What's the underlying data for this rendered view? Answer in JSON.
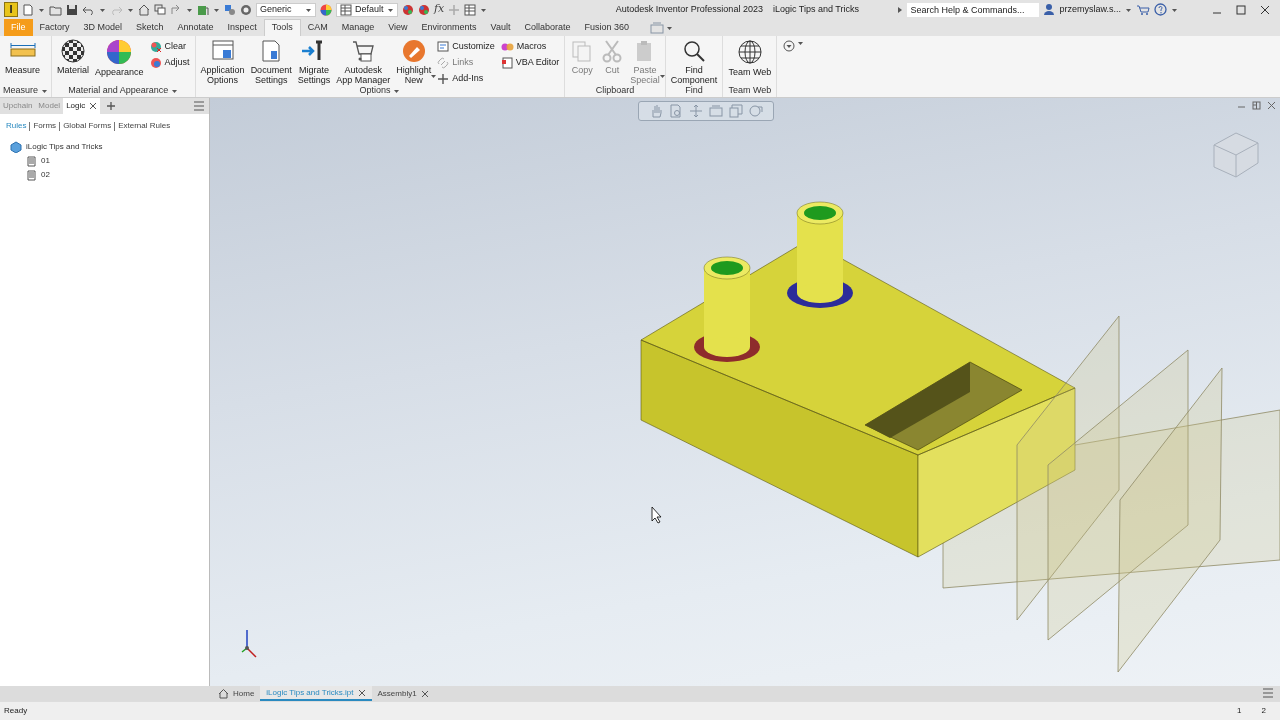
{
  "title_bar": {
    "app_logo": "I",
    "style": "Generic",
    "appearance": "Default",
    "parameters_label": "fx",
    "app_title": "Autodesk Inventor Professional 2023",
    "document_title": "iLogic Tips and Tricks",
    "search": {
      "placeholder": "Search Help & Commands..."
    },
    "user": "przemyslaw.s..."
  },
  "ribbon_tabs": [
    {
      "label": "File",
      "kind": "application",
      "selected": false
    },
    {
      "label": "Factory",
      "kind": "tab",
      "selected": false
    },
    {
      "label": "3D Model",
      "kind": "tab",
      "selected": false
    },
    {
      "label": "Sketch",
      "kind": "tab",
      "selected": false
    },
    {
      "label": "Annotate",
      "kind": "tab",
      "selected": false
    },
    {
      "label": "Inspect",
      "kind": "tab",
      "selected": false
    },
    {
      "label": "Tools",
      "kind": "tab",
      "selected": true
    },
    {
      "label": "CAM",
      "kind": "tab",
      "selected": false
    },
    {
      "label": "Manage",
      "kind": "tab",
      "selected": false
    },
    {
      "label": "View",
      "kind": "tab",
      "selected": false
    },
    {
      "label": "Environments",
      "kind": "tab",
      "selected": false
    },
    {
      "label": "Vault",
      "kind": "tab",
      "selected": false
    },
    {
      "label": "Collaborate",
      "kind": "tab",
      "selected": false
    },
    {
      "label": "Fusion 360",
      "kind": "tab",
      "selected": false
    }
  ],
  "ribbon_panels": [
    {
      "title": "Measure",
      "has_menu": true,
      "commands": [
        {
          "label": "Measure",
          "kind": "large",
          "disabled": false,
          "has_menu": false
        }
      ]
    },
    {
      "title": "Material and Appearance",
      "has_menu": true,
      "commands": [
        {
          "label": "Material",
          "kind": "large",
          "disabled": false,
          "has_menu": false
        },
        {
          "label": "Appearance",
          "kind": "large",
          "disabled": false,
          "has_menu": false
        },
        {
          "label": "Clear",
          "kind": "small",
          "disabled": false,
          "has_menu": false
        },
        {
          "label": "Adjust",
          "kind": "small",
          "disabled": false,
          "has_menu": false
        }
      ]
    },
    {
      "title": "Options",
      "has_menu": true,
      "commands": [
        {
          "label": "Application\nOptions",
          "kind": "large",
          "disabled": false,
          "has_menu": false
        },
        {
          "label": "Document\nSettings",
          "kind": "large",
          "disabled": false,
          "has_menu": false
        },
        {
          "label": "Migrate\nSettings",
          "kind": "large",
          "disabled": false,
          "has_menu": false
        },
        {
          "label": "Autodesk\nApp Manager",
          "kind": "large",
          "disabled": false,
          "has_menu": false
        },
        {
          "label": "Highlight\nNew",
          "kind": "large",
          "disabled": false,
          "has_menu": true
        },
        {
          "label": "Customize",
          "kind": "small",
          "disabled": false,
          "has_menu": false
        },
        {
          "label": "Links",
          "kind": "small",
          "disabled": true,
          "has_menu": false
        },
        {
          "label": "Add-Ins",
          "kind": "small",
          "disabled": false,
          "has_menu": false
        },
        {
          "label": "Macros",
          "kind": "small",
          "disabled": false,
          "has_menu": false
        },
        {
          "label": "VBA Editor",
          "kind": "small",
          "disabled": false,
          "has_menu": false
        }
      ]
    },
    {
      "title": "Clipboard",
      "has_menu": false,
      "commands": [
        {
          "label": "Copy",
          "kind": "large",
          "disabled": true,
          "has_menu": false
        },
        {
          "label": "Cut",
          "kind": "large",
          "disabled": true,
          "has_menu": false
        },
        {
          "label": "Paste\nSpecial",
          "kind": "large",
          "disabled": true,
          "has_menu": true
        }
      ]
    },
    {
      "title": "Find",
      "has_menu": false,
      "commands": [
        {
          "label": "Find\nComponent",
          "kind": "large",
          "disabled": false,
          "has_menu": false
        }
      ]
    },
    {
      "title": "Team Web",
      "has_menu": false,
      "commands": [
        {
          "label": "Team Web",
          "kind": "large",
          "disabled": false,
          "has_menu": false
        }
      ]
    }
  ],
  "browser": {
    "tabs": [
      {
        "label": "Upchain",
        "selected": false,
        "closable": false
      },
      {
        "label": "Model",
        "selected": false,
        "closable": false
      },
      {
        "label": "Logic",
        "selected": true,
        "closable": true
      }
    ],
    "filters": [
      {
        "label": "Rules",
        "selected": true
      },
      {
        "label": "Forms",
        "selected": false
      },
      {
        "label": "Global Forms",
        "selected": false
      },
      {
        "label": "External Rules",
        "selected": false
      }
    ],
    "tree": [
      {
        "label": "iLogic Tips and Tricks",
        "kind": "document",
        "children": [
          {
            "label": "01",
            "kind": "rule"
          },
          {
            "label": "02",
            "kind": "rule"
          }
        ]
      }
    ]
  },
  "document_tabs": [
    {
      "label": "Home",
      "kind": "home",
      "selected": false,
      "closable": false
    },
    {
      "label": "iLogic Tips and Tricks.ipt",
      "kind": "document",
      "selected": true,
      "closable": true
    },
    {
      "label": "Assembly1",
      "kind": "document",
      "selected": false,
      "closable": true
    }
  ],
  "status_bar": {
    "message": "Ready",
    "pages": [
      "1",
      "2"
    ]
  }
}
